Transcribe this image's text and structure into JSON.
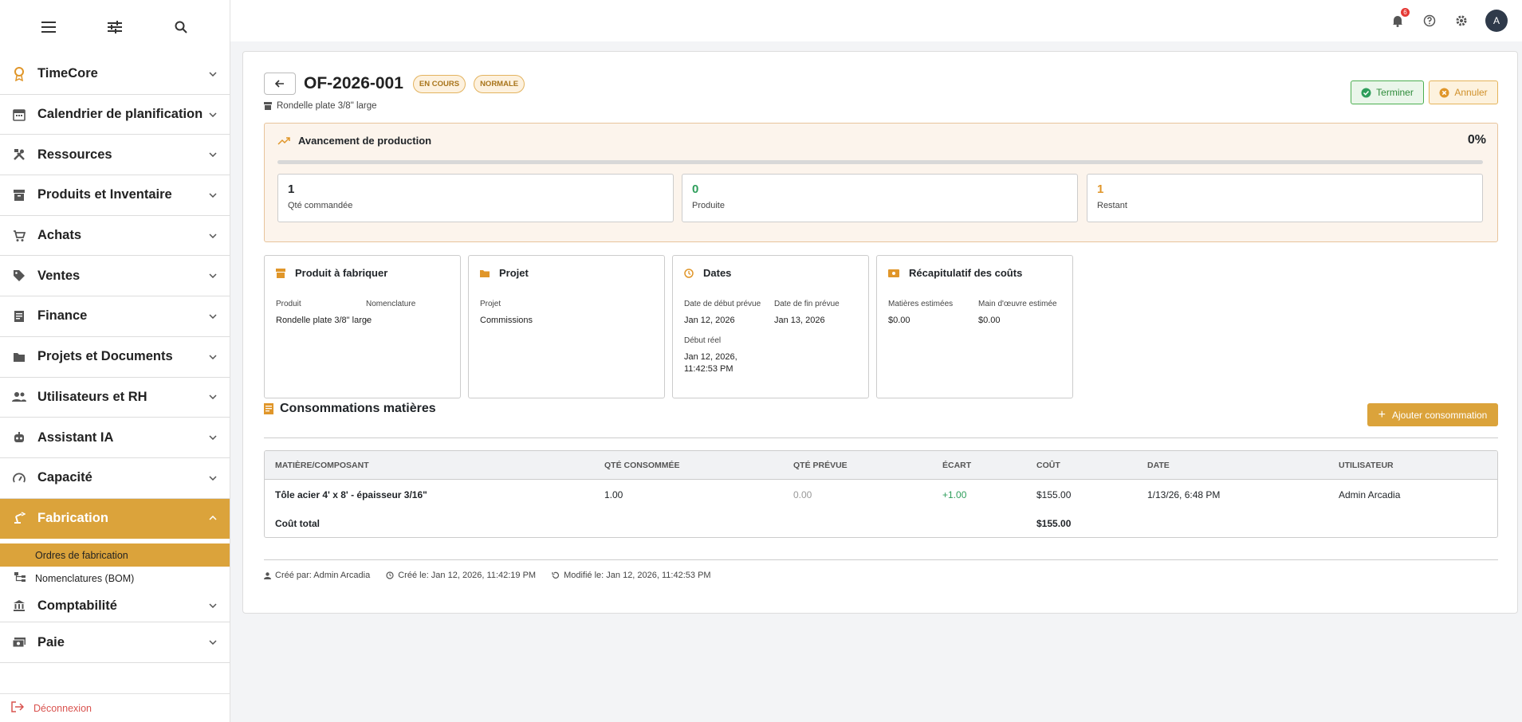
{
  "sidebar": {
    "items": [
      {
        "label": "TimeCore",
        "icon": "timecore-icon"
      },
      {
        "label": "Calendrier de planification",
        "icon": "calendar-icon"
      },
      {
        "label": "Ressources",
        "icon": "tools-icon"
      },
      {
        "label": "Produits et Inventaire",
        "icon": "inventory-icon"
      },
      {
        "label": "Achats",
        "icon": "cart-icon"
      },
      {
        "label": "Ventes",
        "icon": "tag-icon"
      },
      {
        "label": "Finance",
        "icon": "receipt-icon"
      },
      {
        "label": "Projets et Documents",
        "icon": "folder-icon"
      },
      {
        "label": "Utilisateurs et RH",
        "icon": "people-icon"
      },
      {
        "label": "Assistant IA",
        "icon": "robot-icon"
      },
      {
        "label": "Capacité",
        "icon": "gauge-icon"
      },
      {
        "label": "Fabrication",
        "icon": "robot-arm-icon"
      },
      {
        "label": "Comptabilité",
        "icon": "bank-icon"
      },
      {
        "label": "Paie",
        "icon": "payments-icon"
      }
    ],
    "sub_items": [
      "Ordres de fabrication",
      "Nomenclatures (BOM)"
    ],
    "logout": "Déconnexion"
  },
  "topbar": {
    "notif_count": "6",
    "avatar": "A"
  },
  "order": {
    "number": "OF-2026-001",
    "status": "EN COURS",
    "priority": "NORMALE",
    "product": "Rondelle plate 3/8\" large",
    "btn_finish": "Terminer",
    "btn_cancel": "Annuler"
  },
  "progress": {
    "title": "Avancement de production",
    "percent_label": "0%",
    "percent": 0,
    "stats": [
      {
        "value": "1",
        "label": "Qté commandée",
        "color": "#212529"
      },
      {
        "value": "0",
        "label": "Produite",
        "color": "#2e9e5b"
      },
      {
        "value": "1",
        "label": "Restant",
        "color": "#e0962a"
      }
    ]
  },
  "cards": {
    "product": {
      "title": "Produit à fabriquer",
      "f1_label": "Produit",
      "f1_value": "Rondelle plate 3/8\" large",
      "f2_label": "Nomenclature",
      "f2_value": "-"
    },
    "project": {
      "title": "Projet",
      "f1_label": "Projet",
      "f1_value": "Commissions"
    },
    "dates": {
      "title": "Dates",
      "start_label": "Date de début prévue",
      "start_value": "Jan 12, 2026",
      "end_label": "Date de fin prévue",
      "end_value": "Jan 13, 2026",
      "real_label": "Début réel",
      "real_value": "Jan 12, 2026, 11:42:53 PM"
    },
    "costs": {
      "title": "Récapitulatif des coûts",
      "mat_label": "Matières estimées",
      "mat_value": "$0.00",
      "labor_label": "Main d'œuvre estimée",
      "labor_value": "$0.00"
    }
  },
  "consumption": {
    "title": "Consommations matières",
    "add_button": "Ajouter consommation",
    "headers": [
      "MATIÈRE/COMPOSANT",
      "QTÉ CONSOMMÉE",
      "QTÉ PRÉVUE",
      "ÉCART",
      "COÛT",
      "DATE",
      "UTILISATEUR"
    ],
    "rows": [
      {
        "material": "Tôle acier 4' x 8' - épaisseur 3/16\"",
        "consumed": "1.00",
        "planned": "0.00",
        "diff": "+1.00",
        "cost": "$155.00",
        "date": "1/13/26, 6:48 PM",
        "user": "Admin Arcadia"
      }
    ],
    "total_label": "Coût total",
    "total_value": "$155.00"
  },
  "footer": {
    "created_by": "Créé par: Admin Arcadia",
    "created_at": "Créé le: Jan 12, 2026, 11:42:19 PM",
    "modified_at": "Modifié le: Jan 12, 2026, 11:42:53 PM"
  }
}
